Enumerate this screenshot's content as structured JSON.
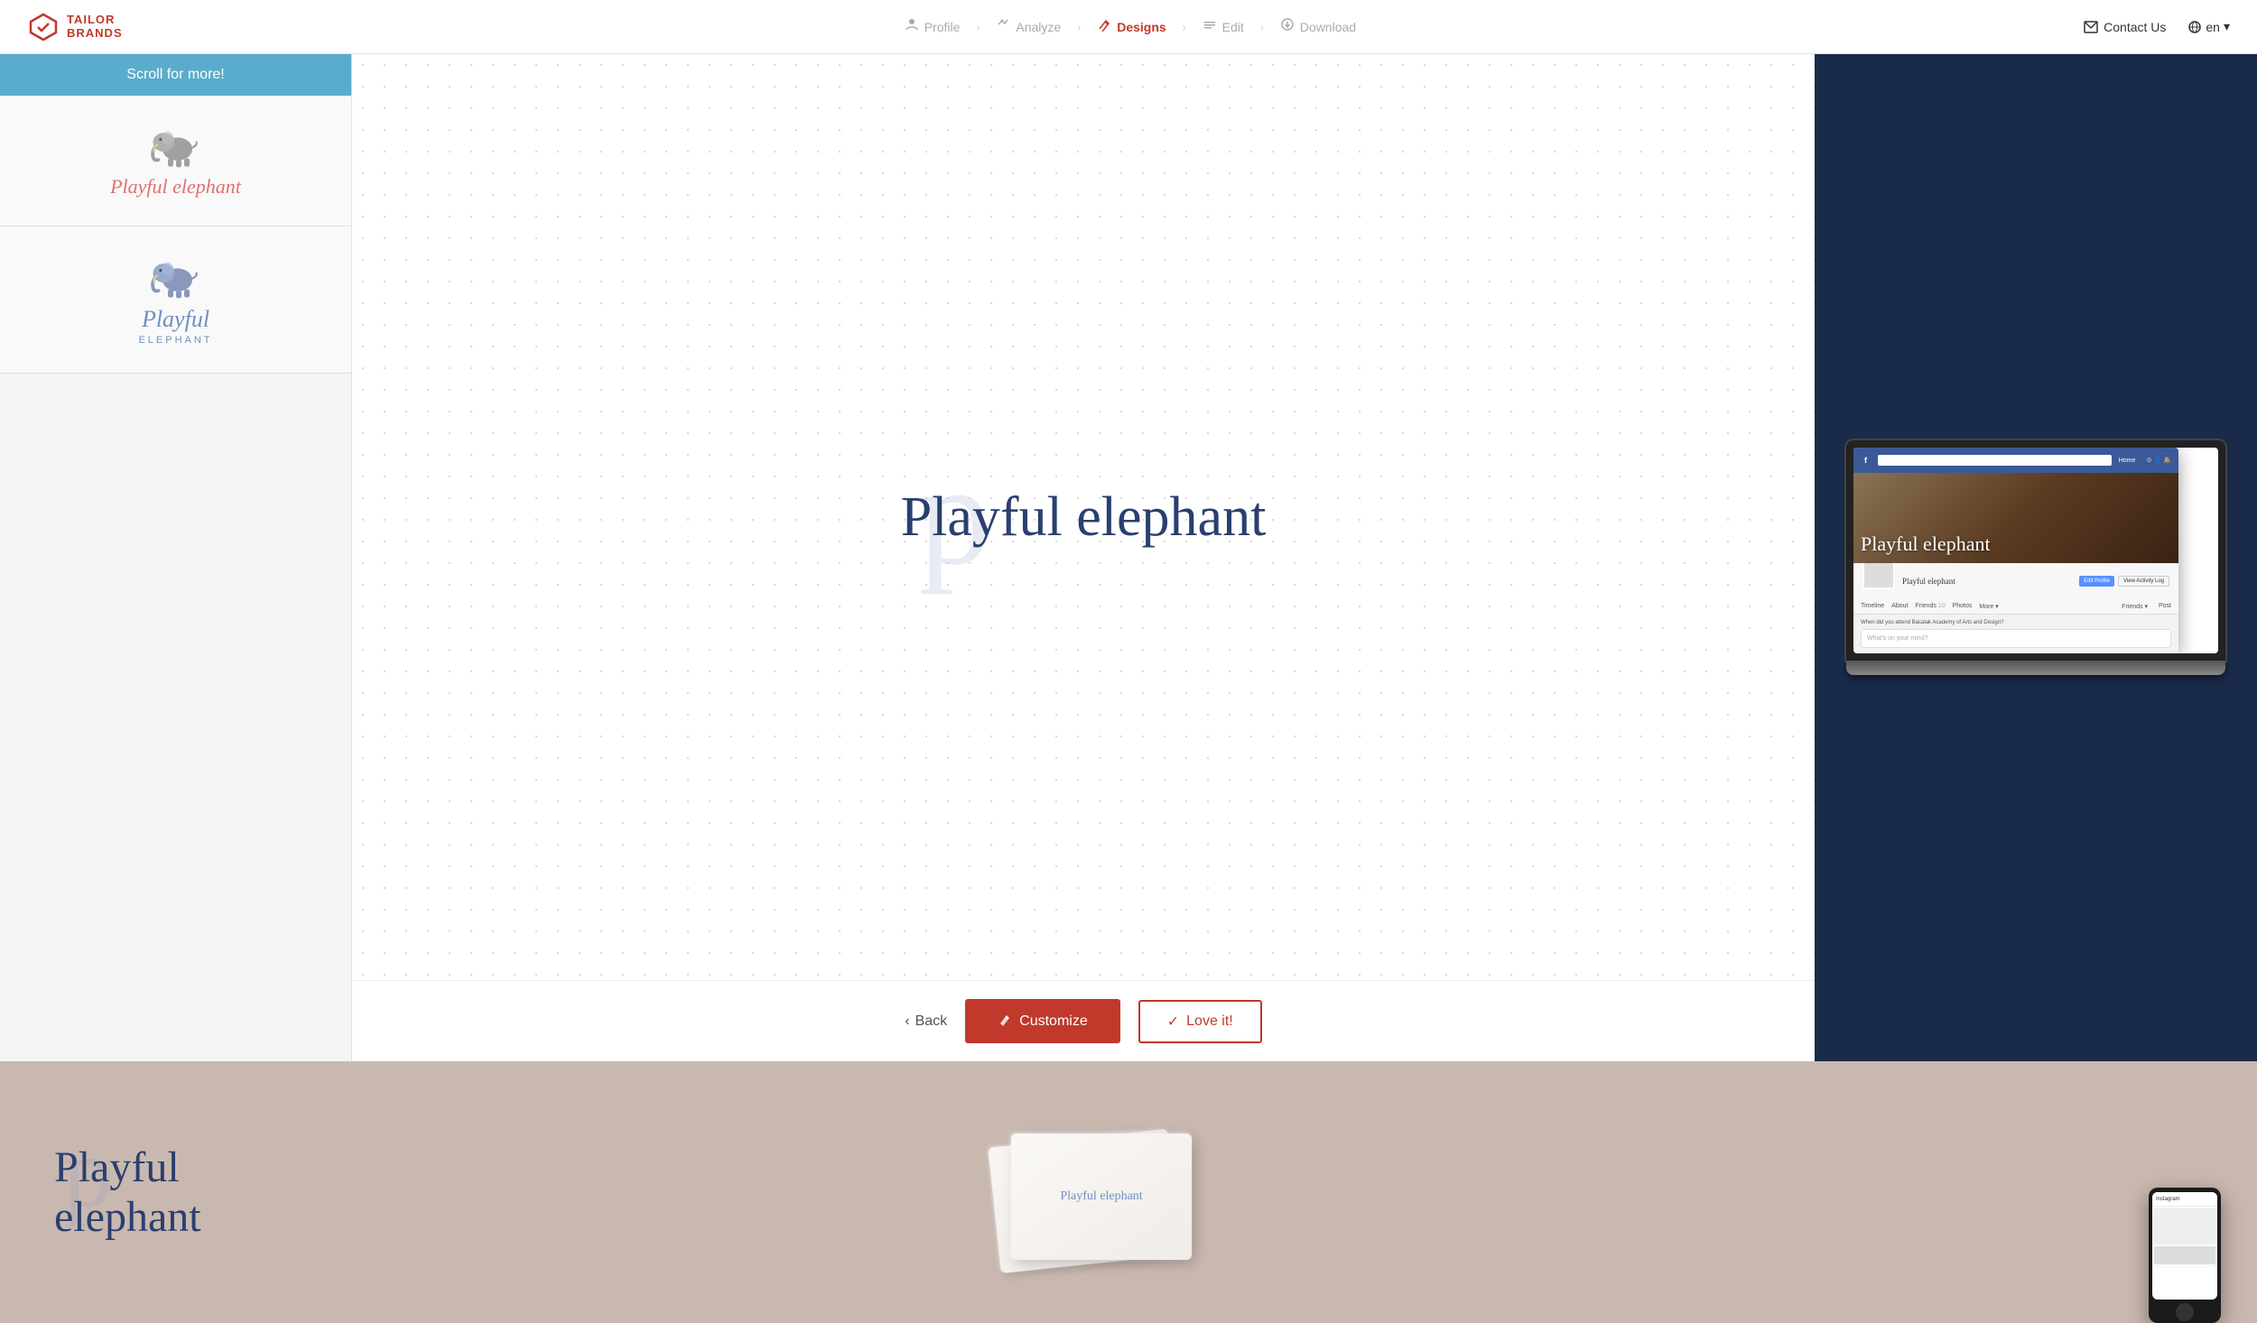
{
  "navbar": {
    "logo_tailor": "TAILOR",
    "logo_brands": "BRANDS",
    "steps": [
      {
        "label": "Profile",
        "icon": "👤",
        "active": false
      },
      {
        "label": "Analyze",
        "icon": "🔀",
        "active": false
      },
      {
        "label": "Designs",
        "icon": "✏️",
        "active": true
      },
      {
        "label": "Edit",
        "icon": "⚙️",
        "active": false
      },
      {
        "label": "Download",
        "icon": "⬇️",
        "active": false
      }
    ],
    "contact_us": "Contact Us",
    "lang": "en"
  },
  "sidebar": {
    "scroll_banner": "Scroll for more!",
    "logo_name_1": "Playful elephant",
    "logo_name_2_line1": "Playful",
    "logo_name_2_line2": "ELEPHANT"
  },
  "main": {
    "brand_name": "Playful elephant",
    "back_label": "Back",
    "customize_label": "Customize",
    "love_label": "Love it!"
  },
  "facebook_mockup": {
    "page_title": "Playful elephant",
    "tabs": [
      "Timeline",
      "About",
      "Friends",
      "Photos",
      "More"
    ]
  },
  "bottom": {
    "brand_name": "Playful elephant"
  },
  "colors": {
    "accent": "#c0392b",
    "nav_active": "#c0392b",
    "dark_blue": "#1a2a4a",
    "script_blue": "#2a3f6f",
    "banner_blue": "#5aaccc",
    "bottom_bg": "#c9b8b0"
  }
}
